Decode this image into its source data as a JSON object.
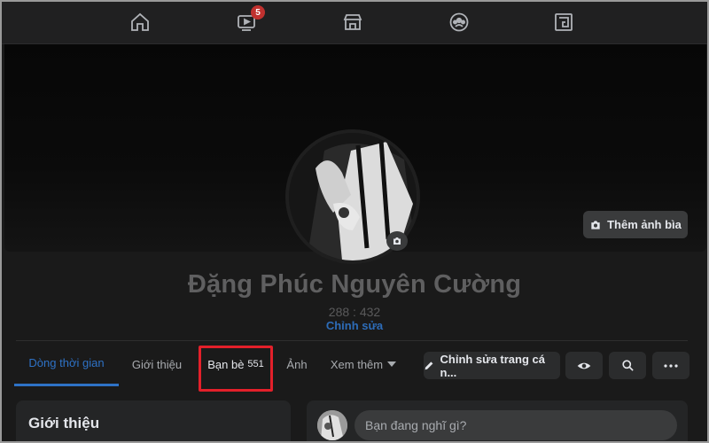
{
  "nav": {
    "items": [
      {
        "icon": "home-icon"
      },
      {
        "icon": "watch-icon",
        "badge": "5"
      },
      {
        "icon": "marketplace-icon"
      },
      {
        "icon": "groups-icon"
      },
      {
        "icon": "gaming-icon"
      }
    ]
  },
  "cover": {
    "add_cover_label": "Thêm ảnh bìa"
  },
  "profile": {
    "name": "Đặng Phúc Nguyên Cường",
    "stats": "288 : 432",
    "edit_label": "Chỉnh sửa"
  },
  "tabs": [
    {
      "label": "Dòng thời gian"
    },
    {
      "label": "Giới thiệu"
    },
    {
      "label": "Bạn bè",
      "count": "551"
    },
    {
      "label": "Ảnh"
    },
    {
      "label": "Xem thêm"
    }
  ],
  "actions": {
    "edit_profile_label": "Chỉnh sửa trang cá n...",
    "view_icon": "eye-icon",
    "search_icon": "search-icon",
    "more_icon": "more-icon"
  },
  "intro": {
    "title": "Giới thiệu"
  },
  "composer": {
    "placeholder": "Bạn đang nghĩ gì?"
  },
  "colors": {
    "accent": "#2e72c6",
    "highlight": "#e3202a",
    "badge": "#c0312f"
  }
}
